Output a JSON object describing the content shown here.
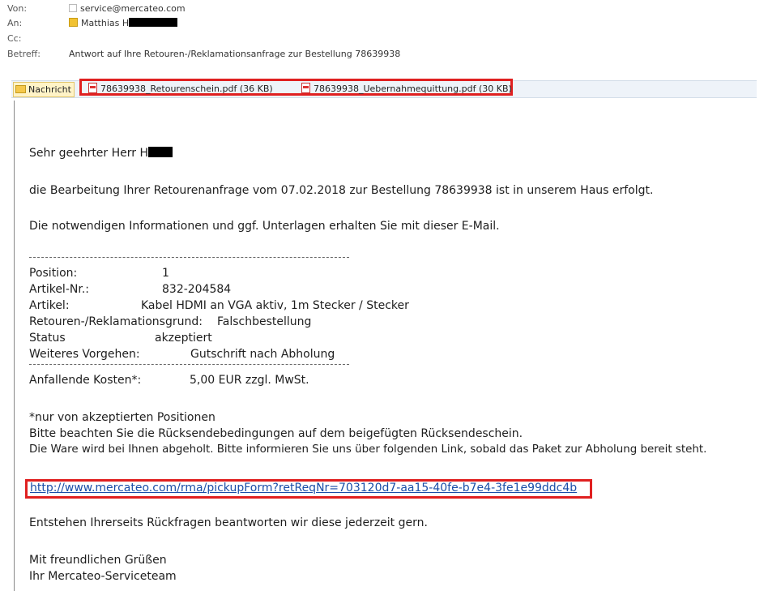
{
  "header": {
    "from_label": "Von:",
    "from_value": "service@mercateo.com",
    "to_label": "An:",
    "to_value": "Matthias H",
    "cc_label": "Cc:",
    "subject_label": "Betreff:",
    "subject_value": "Antwort auf Ihre Retouren-/Reklamationsanfrage zur Bestellung 78639938"
  },
  "tabs": {
    "message_label": "Nachricht",
    "attachments": [
      {
        "name": "78639938_Retourenschein.pdf (36 KB)"
      },
      {
        "name": "78639938_Uebernahmequittung.pdf (30 KB)"
      }
    ]
  },
  "body": {
    "greeting": "Sehr geehrter Herr H",
    "line1": "die Bearbeitung Ihrer Retourenanfrage vom 07.02.2018 zur Bestellung 78639938 ist in unserem Haus erfolgt.",
    "line2": "Die notwendigen Informationen und ggf. Unterlagen erhalten Sie mit dieser E-Mail.",
    "details": {
      "position_label": "Position:",
      "position_value": "1",
      "article_no_label": "Artikel-Nr.:",
      "article_no_value": "832-204584",
      "article_label": "Artikel:",
      "article_value": "Kabel HDMI an VGA aktiv, 1m Stecker / Stecker",
      "reason_label": "Retouren-/Reklamationsgrund:",
      "reason_value": "Falschbestellung",
      "status_label": "Status",
      "status_value": "akzeptiert",
      "next_label": "Weiteres Vorgehen:",
      "next_value": "Gutschrift nach Abholung"
    },
    "costs_label": "Anfallende Kosten*:",
    "costs_value": "5,00 EUR zzgl. MwSt.",
    "footnote": "*nur von akzeptierten Positionen",
    "note1": "Bitte beachten Sie die Rücksendebedingungen auf dem beigefügten Rücksendeschein.",
    "note2": "Die Ware wird bei Ihnen abgeholt. Bitte informieren Sie uns über folgenden Link, sobald das Paket zur Abholung bereit steht.",
    "link": "http://www.mercateo.com/rma/pickupForm?retReqNr=703120d7-aa15-40fe-b7e4-3fe1e99ddc4b",
    "questions": "Entstehen Ihrerseits Rückfragen beantworten wir diese jederzeit gern.",
    "closing1": "Mit freundlichen Grüßen",
    "closing2": "Ihr Mercateo-Serviceteam"
  }
}
